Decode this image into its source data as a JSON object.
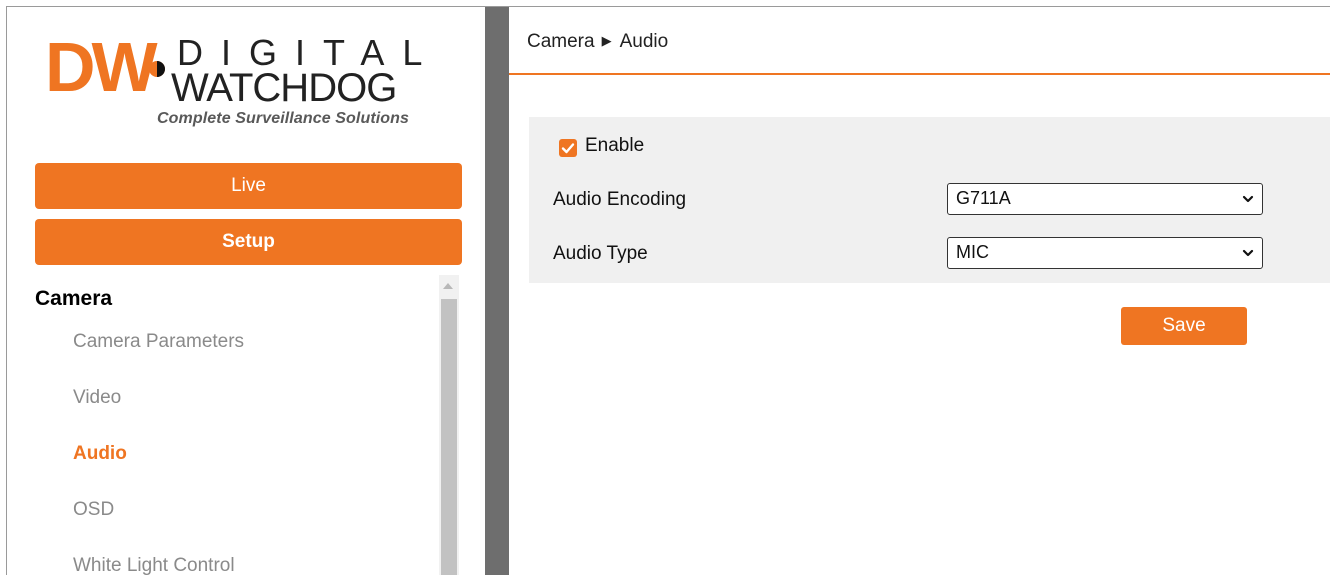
{
  "brand": {
    "logo_letters": "DW",
    "logo_word1": "DIGITAL",
    "logo_word2": "WATCHDOG",
    "tagline": "Complete Surveillance Solutions",
    "accent_color": "#ef7522"
  },
  "nav": {
    "live_label": "Live",
    "setup_label": "Setup"
  },
  "menu": {
    "heading": "Camera",
    "items": [
      {
        "label": "Camera Parameters",
        "active": false
      },
      {
        "label": "Video",
        "active": false
      },
      {
        "label": "Audio",
        "active": true
      },
      {
        "label": "OSD",
        "active": false
      },
      {
        "label": "White Light Control",
        "active": false
      }
    ]
  },
  "breadcrumb": {
    "section": "Camera",
    "separator": "▶",
    "page": "Audio"
  },
  "form": {
    "enable_label": "Enable",
    "enable_checked": true,
    "audio_encoding_label": "Audio Encoding",
    "audio_encoding_value": "G711A",
    "audio_type_label": "Audio Type",
    "audio_type_value": "MIC",
    "save_label": "Save"
  },
  "icons": {
    "checkbox": "check-icon",
    "dropdown": "chevron-down-icon",
    "scroll_up": "scroll-up-arrow-icon"
  }
}
